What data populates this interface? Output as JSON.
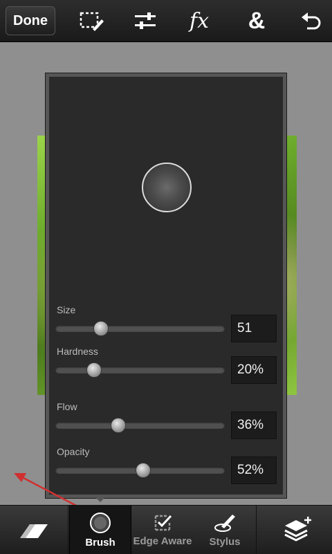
{
  "toolbar": {
    "done_label": "Done",
    "tools": [
      {
        "icon": "selection-edit-icon"
      },
      {
        "icon": "adjustments-icon"
      },
      {
        "icon": "effects-fx-icon"
      },
      {
        "icon": "combine-ampersand-icon"
      },
      {
        "icon": "undo-icon"
      }
    ],
    "fx_label": "fx",
    "amp_label": "&"
  },
  "brush_panel": {
    "sliders": [
      {
        "label": "Size",
        "value": "51",
        "fraction": 0.27
      },
      {
        "label": "Hardness",
        "value": "20%",
        "fraction": 0.23
      },
      {
        "label": "Flow",
        "value": "36%",
        "fraction": 0.37
      },
      {
        "label": "Opacity",
        "value": "52%",
        "fraction": 0.52
      }
    ]
  },
  "bottom_bar": {
    "eraser_icon": "eraser-icon",
    "brush_label": "Brush",
    "edge_aware_label": "Edge Aware",
    "stylus_label": "Stylus",
    "layers_icon": "layers-add-icon"
  },
  "colors": {
    "annotation_arrow": "#d03030",
    "panel_bg": "#2a2a2a",
    "canvas_bg": "#8f8f8f"
  }
}
